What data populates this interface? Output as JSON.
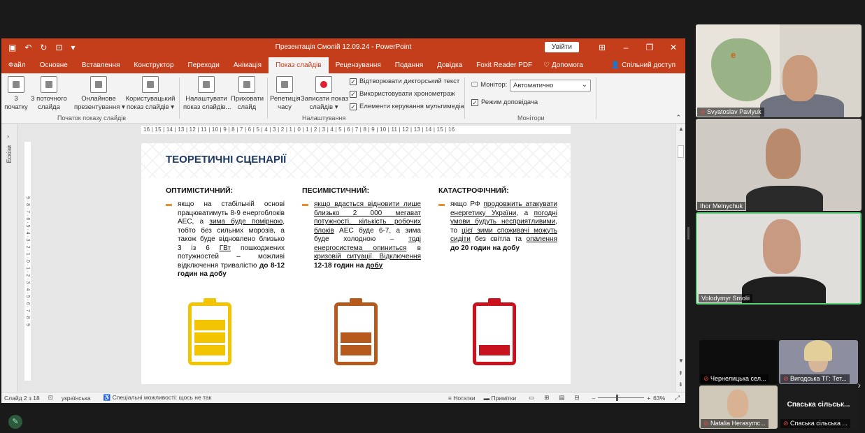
{
  "powerpoint": {
    "title": "Презентація Смолій 12.09.24  -  PowerPoint",
    "signin_label": "Увійти",
    "tabs": [
      "Файл",
      "Основне",
      "Вставлення",
      "Конструктор",
      "Переходи",
      "Анімація",
      "Показ слайдів",
      "Рецензування",
      "Подання",
      "Довідка",
      "Foxit Reader PDF"
    ],
    "active_tab": "Показ слайдів",
    "help_label": "Допомога",
    "share_label": "Спільний доступ",
    "ribbon": {
      "from_start": "3\nпочатку",
      "from_current": "3 поточного\nслайда",
      "online": "Онлайнове\nпрезентування ▾",
      "custom": "Користувацький\nпоказ слайдів ▾",
      "group_start": "Початок показу слайдів",
      "setup": "Налаштувати\nпоказ слайдів...",
      "hide": "Приховати\nслайд",
      "rehearse": "Репетиція\nчасу",
      "record": "Записати показ\nслайдів ▾",
      "chk_narration": "Відтворювати дикторський текст",
      "chk_timings": "Використовувати хронометраж",
      "chk_media": "Елементи керування мультимедіа",
      "group_setup": "Налаштування",
      "monitor_label": "Монітор:",
      "monitor_value": "Автоматично",
      "chk_presenter": "Режим доповідача",
      "group_monitors": "Монітори"
    },
    "thumbs_label": "Ескізи",
    "ruler_text": "16 | 15 | 14 | 13 | 12 | 11 | 10 | 9 | 8 | 7 | 6 | 5 | 4 | 3 | 2 | 1 | 0 | 1 | 2 | 3 | 4 | 5 | 6 | 7 | 8 | 9 | 10 | 11 | 12 | 13 | 14 | 15 | 16",
    "vruler_text": "9 · 8 · 7 · 6 · 5 · 4 · 3 · 2 · 1 · 0 · 1 · 2 · 3 · 4 · 5 · 6 · 7 · 8 · 9",
    "status": {
      "slide": "Слайд 2 з 18",
      "lang": "українська",
      "accessibility": "Спеціальні можливості: щось не так",
      "notes": "Нотатки",
      "comments": "Примітки",
      "zoom": "63%"
    }
  },
  "slide": {
    "title": "ТЕОРЕТИЧНІ СЦЕНАРІЇ",
    "columns": [
      {
        "heading": "ОПТИМІСТИЧНИЙ:",
        "text_a": "якщо на стабільній основі працюватимуть 8-9 енергоблоків АЕС, а ",
        "u1": "зима буде помірною",
        "text_b": ", тобто без сильних морозів, а також буде відновлено близько 3 із 6 ",
        "u2": "ГВт",
        "text_c": " пошкоджених потужностей – можливі відключення тривалістю ",
        "bold": "до 8-12 годин на добу"
      },
      {
        "heading": "ПЕСИМІСТИЧНИЙ:",
        "u1": "якщо вдасться відновити лише близько 2 000 мегават потужності, кількість робочих блоків",
        "text_a": " АЕС буде 6-7, а зима буде холодною – ",
        "u2": "тоді енергосистема опиниться",
        "text_b": " в ",
        "u3": "кризовій ситуації. Відключення",
        "bold": " 12-18 годин на ",
        "u4": "добу"
      },
      {
        "heading": "КАТАСТРОФІЧНИЙ:",
        "text_a": "якщо РФ ",
        "u1": "продовжить атакувати енергетику України",
        "text_b": ", а ",
        "u2": "погодні умови будуть несприятливими",
        "text_c": ", то ",
        "u3": "цієї зими споживачі можуть сидіти",
        "text_d": " без світла та ",
        "u4": "опалення",
        "bold": " до 20 годин на добу"
      }
    ],
    "batteries": [
      {
        "color": "#f2c500",
        "level": "3/3"
      },
      {
        "color": "#b55a1c",
        "level": "2/3"
      },
      {
        "color": "#c8121e",
        "level": "1/3"
      }
    ]
  },
  "participants": [
    {
      "name": "Svyatoslav Pavlyuk"
    },
    {
      "name": "Ihor Melnychuk"
    },
    {
      "name": "Volodymyr Smolii"
    },
    {
      "name": "Чернелицька сел..."
    },
    {
      "name": "Вигодська ТГ: Тет..."
    },
    {
      "name": "Natalia Herasymc..."
    },
    {
      "name": "Спаська сільська ...",
      "title": "Спаська сільськ..."
    }
  ]
}
